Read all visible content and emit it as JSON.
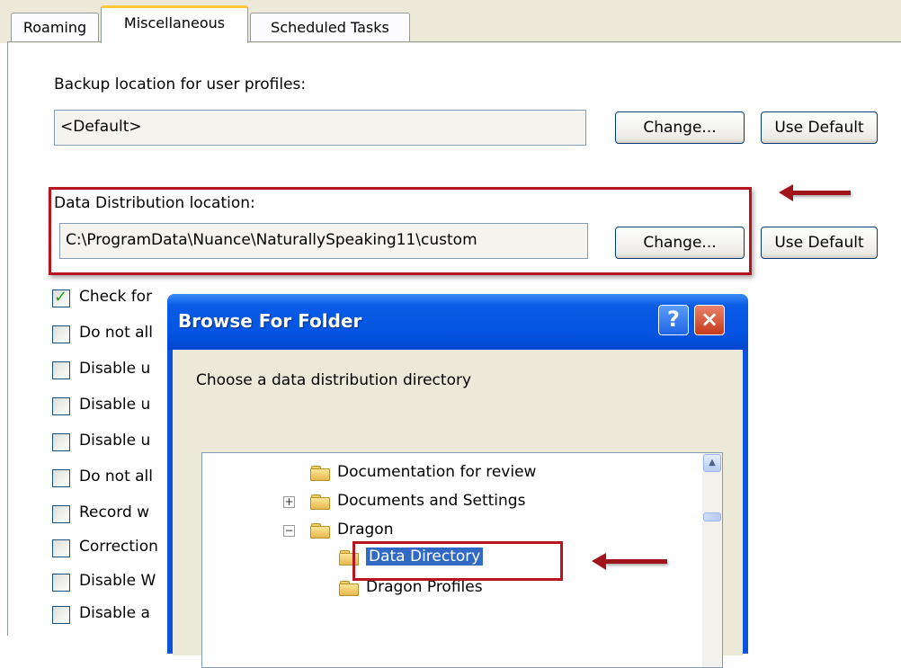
{
  "tabs": [
    "Roaming",
    "Miscellaneous",
    "Scheduled Tasks"
  ],
  "backup": {
    "label": "Backup location for user profiles:",
    "value": "<Default>",
    "change_label": "Change...",
    "default_label": "Use Default"
  },
  "distribution": {
    "label": "Data Distribution location:",
    "value": "C:\\ProgramData\\Nuance\\NaturallySpeaking11\\custom",
    "change_label": "Change...",
    "default_label": "Use Default"
  },
  "checkboxes": [
    {
      "label": "Check for",
      "checked": true
    },
    {
      "label": "Do not all",
      "checked": false
    },
    {
      "label": "Disable u",
      "checked": false
    },
    {
      "label": "Disable u",
      "checked": false
    },
    {
      "label": "Disable u",
      "checked": false
    },
    {
      "label": "Do not all",
      "checked": false
    },
    {
      "label": "Record w",
      "checked": false
    },
    {
      "label": "Correction",
      "checked": false
    },
    {
      "label": "Disable W",
      "checked": false
    },
    {
      "label": "Disable a",
      "checked": false
    }
  ],
  "dialog": {
    "title": "Browse For Folder",
    "help_label": "?",
    "close_label": "×",
    "prompt": "Choose a data distribution directory",
    "tree": [
      {
        "label": "Documentation for review",
        "expander": "",
        "selected": false
      },
      {
        "label": "Documents and Settings",
        "expander": "+",
        "selected": false
      },
      {
        "label": "Dragon",
        "expander": "−",
        "selected": false
      },
      {
        "label": "Data Directory",
        "expander": "",
        "selected": true
      },
      {
        "label": "Dragon Profiles",
        "expander": "",
        "selected": false
      }
    ],
    "scroll_up_label": "▲"
  },
  "colors": {
    "highlight_box": "#b8141e",
    "title_bar": "#0554e3",
    "selection": "#316ac5"
  }
}
